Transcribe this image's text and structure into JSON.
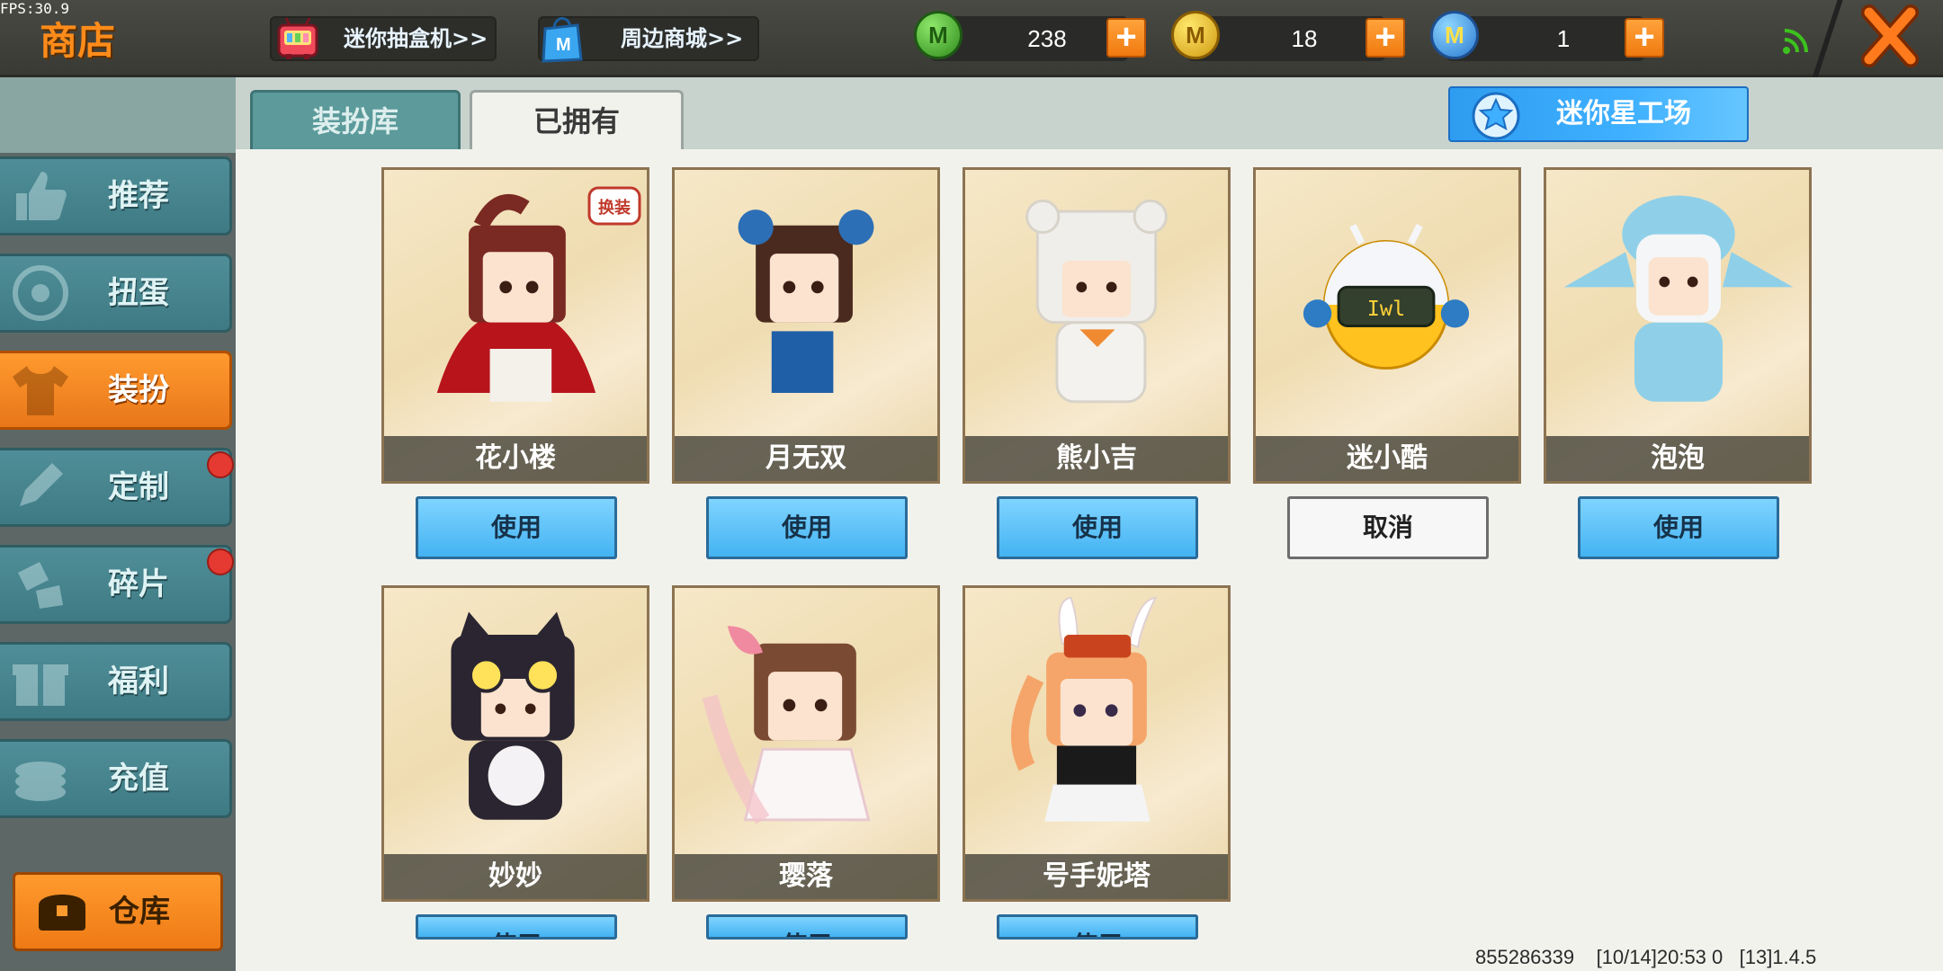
{
  "fps": "FPS:30.9",
  "header": {
    "title": "商店",
    "links": [
      {
        "label": "迷你抽盒机>>",
        "icon": "gift-machine-icon"
      },
      {
        "label": "周边商城>>",
        "icon": "shopping-bag-icon"
      }
    ],
    "currencies": [
      {
        "name": "green-coin",
        "value": "238",
        "color": "#3ea127"
      },
      {
        "name": "gold-coin",
        "value": "18",
        "color": "#e4b21e"
      },
      {
        "name": "blue-coin",
        "value": "1",
        "color": "#3c8ee0"
      }
    ],
    "plus_label": "+",
    "close_icon": "close-icon",
    "signal_icon": "signal-icon"
  },
  "sidebar": {
    "items": [
      {
        "label": "推荐",
        "icon": "thumbs-up-icon",
        "active": false,
        "dot": false
      },
      {
        "label": "扭蛋",
        "icon": "capsule-icon",
        "active": false,
        "dot": false
      },
      {
        "label": "装扮",
        "icon": "shirt-icon",
        "active": true,
        "dot": false
      },
      {
        "label": "定制",
        "icon": "pencil-icon",
        "active": false,
        "dot": true
      },
      {
        "label": "碎片",
        "icon": "shards-icon",
        "active": false,
        "dot": true
      },
      {
        "label": "福利",
        "icon": "gift-icon",
        "active": false,
        "dot": false
      },
      {
        "label": "充值",
        "icon": "coins-icon",
        "active": false,
        "dot": false
      }
    ],
    "warehouse_label": "仓库"
  },
  "tabs": {
    "library": "装扮库",
    "owned": "已拥有"
  },
  "studio_label": "迷你星工场",
  "skins": [
    {
      "name": "花小楼",
      "action": "使用",
      "badge": "换装"
    },
    {
      "name": "月无双",
      "action": "使用"
    },
    {
      "name": "熊小吉",
      "action": "使用"
    },
    {
      "name": "迷小酷",
      "action": "取消"
    },
    {
      "name": "泡泡",
      "action": "使用"
    },
    {
      "name": "妙妙",
      "action": "使用"
    },
    {
      "name": "璎落",
      "action": "使用"
    },
    {
      "name": "号手妮塔",
      "action": "使用"
    }
  ],
  "status": {
    "uid": "855286339",
    "time": "[10/14]20:53 0",
    "version": "[13]1.4.5"
  }
}
